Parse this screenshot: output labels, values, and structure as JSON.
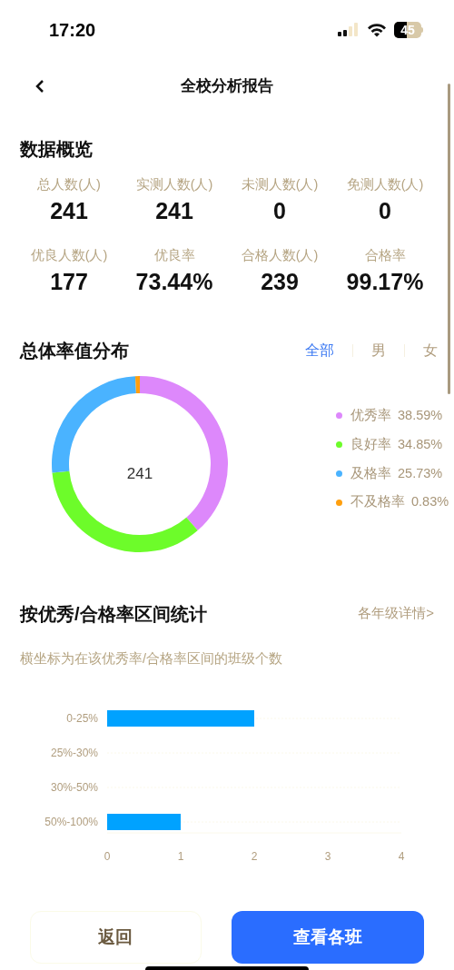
{
  "status_bar": {
    "time": "17:20",
    "battery": "45"
  },
  "header": {
    "title": "全校分析报告"
  },
  "overview": {
    "title": "数据概览",
    "stats": [
      {
        "label": "总人数(人)",
        "value": "241"
      },
      {
        "label": "实测人数(人)",
        "value": "241"
      },
      {
        "label": "未测人数(人)",
        "value": "0"
      },
      {
        "label": "免测人数(人)",
        "value": "0"
      },
      {
        "label": "优良人数(人)",
        "value": "177"
      },
      {
        "label": "优良率",
        "value": "73.44%"
      },
      {
        "label": "合格人数(人)",
        "value": "239"
      },
      {
        "label": "合格率",
        "value": "99.17%"
      }
    ]
  },
  "distribution": {
    "title": "总体率值分布",
    "tabs": [
      {
        "label": "全部",
        "selected": true
      },
      {
        "label": "男",
        "selected": false
      },
      {
        "label": "女",
        "selected": false
      }
    ],
    "center_value": "241",
    "legend": [
      {
        "value": "38.59%",
        "color": "#dd88fb"
      },
      {
        "value": "34.85%",
        "color": "#6dfc2a"
      },
      {
        "value": "25.73%",
        "color": "#4ab3ff"
      },
      {
        "value": "0.83%",
        "color": "#ff9f0e"
      }
    ],
    "chart_data": {
      "type": "donut",
      "categories": [
        "优秀率",
        "良好率",
        "及格率",
        "不及格率"
      ],
      "values": [
        38.59,
        34.85,
        25.73,
        0.83
      ]
    }
  },
  "interval_stats": {
    "title": "按优秀/合格率区间统计",
    "link": "各年级详情>",
    "note": "横坐标为在该优秀率/合格率区间的班级个数",
    "chart_data": {
      "type": "bar",
      "orientation": "horizontal",
      "categories": [
        "0-25%",
        "25%-30%",
        "30%-50%",
        "50%-100%"
      ],
      "series": [
        {
          "color": "#00a2ff",
          "values": [
            2,
            0,
            0,
            1
          ]
        }
      ],
      "xlim": [
        0,
        4
      ],
      "xticks": [
        0,
        1,
        2,
        3,
        4
      ]
    }
  },
  "buttons": [
    {
      "label": "返回",
      "kind": "secondary"
    },
    {
      "label": "查看各班",
      "kind": "primary"
    }
  ]
}
